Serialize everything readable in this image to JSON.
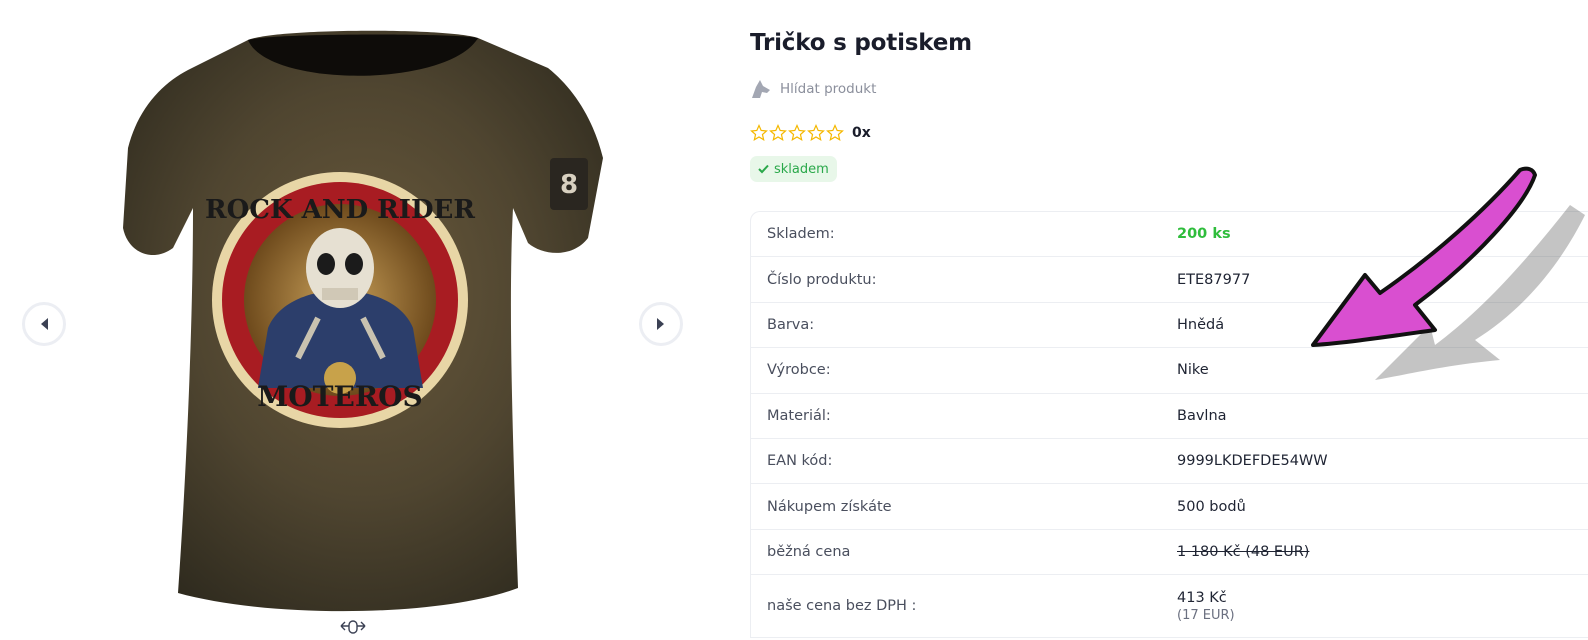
{
  "product": {
    "title": "Tričko s potiskem",
    "watch_label": "Hlídat produkt",
    "rating_count": "0x",
    "rating_value": 0,
    "rating_max": 5,
    "stock_badge": "skladem"
  },
  "image": {
    "print_top_text": "ROCK AND RIDER",
    "print_bottom_text": "MOTEROS",
    "sleeve_patch": "8"
  },
  "params": [
    {
      "label": "Skladem:",
      "value": "200 ks"
    },
    {
      "label": "Číslo produktu:",
      "value": "ETE87977"
    },
    {
      "label": "Barva:",
      "value": "Hnědá"
    },
    {
      "label": "Výrobce:",
      "value": "Nike"
    },
    {
      "label": "Materiál:",
      "value": "Bavlna"
    },
    {
      "label": "EAN kód:",
      "value": "9999LKDEFDE54WW"
    },
    {
      "label": "Nákupem získáte",
      "value": "500 bodů"
    },
    {
      "label": "běžná cena",
      "value": "1 180 Kč (48 EUR)"
    },
    {
      "label": "naše cena bez DPH :",
      "value": "413 Kč",
      "sub": "(17 EUR)"
    }
  ],
  "colors": {
    "accent_green": "#2fbd3c",
    "badge_bg": "#e8f7e9",
    "star": "#f5b800",
    "arrow_magenta": "#d94fd0"
  },
  "icons": [
    "chevron-left-icon",
    "chevron-right-icon",
    "dog-icon",
    "star-icon",
    "check-icon",
    "scroll-icon"
  ]
}
